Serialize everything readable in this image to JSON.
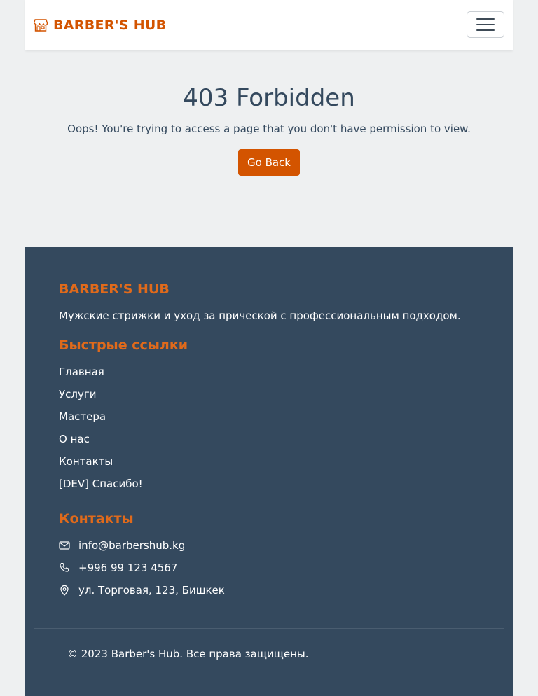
{
  "navbar": {
    "brand": "BARBER'S HUB",
    "brand_icon": "shop-icon",
    "toggle_icon": "hamburger-menu-icon"
  },
  "error": {
    "title": "403 Forbidden",
    "message": "Oops! You're trying to access a page that you don't have permission to view.",
    "button_label": "Go Back"
  },
  "footer": {
    "brand": "BARBER'S HUB",
    "description": "Мужские стрижки и уход за прической с профессиональным подходом.",
    "links_heading": "Быстрые ссылки",
    "links": [
      {
        "label": "Главная"
      },
      {
        "label": "Услуги"
      },
      {
        "label": "Мастера"
      },
      {
        "label": "О нас"
      },
      {
        "label": "Контакты"
      },
      {
        "label": "[DEV] Спасибо!"
      }
    ],
    "contacts_heading": "Контакты",
    "contacts": [
      {
        "icon": "envelope-icon",
        "text": "info@barbershub.kg"
      },
      {
        "icon": "phone-icon",
        "text": "+996 99 123 4567"
      },
      {
        "icon": "map-pin-icon",
        "text": "ул. Торговая, 123, Бишкек"
      }
    ],
    "copyright": "© 2023 Barber's Hub. Все права защищены."
  },
  "colors": {
    "accent": "#d35400",
    "footer_bg": "#34495e",
    "page_bg": "#eef0f1"
  }
}
